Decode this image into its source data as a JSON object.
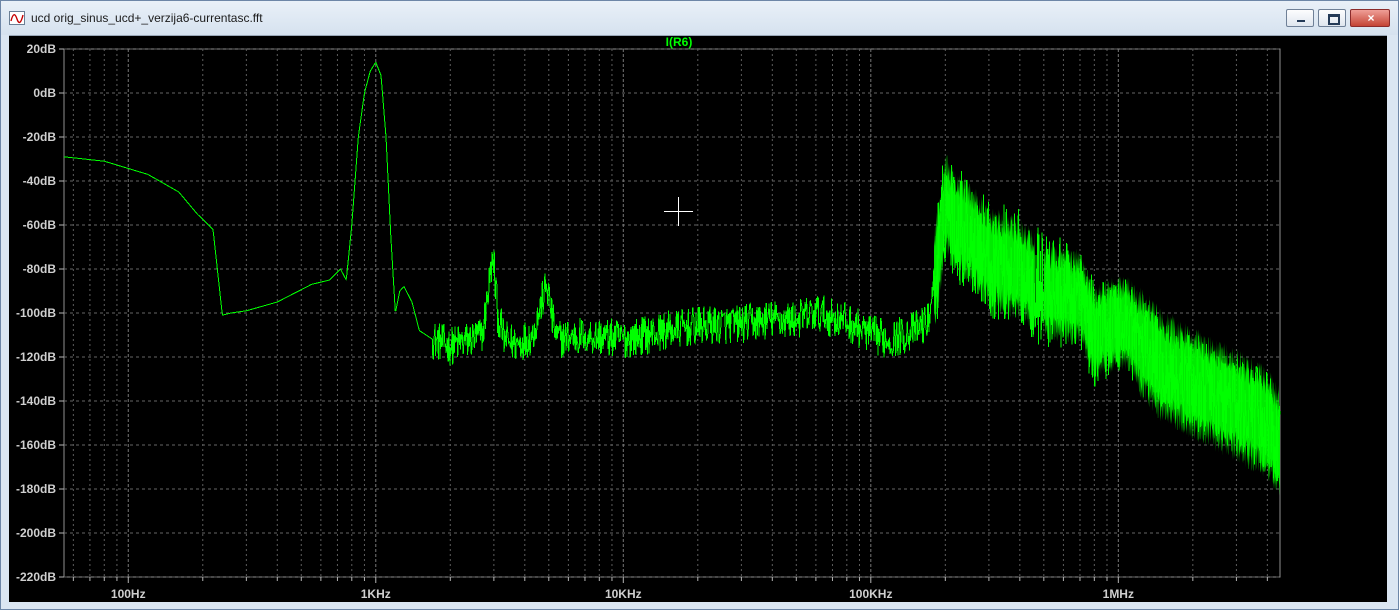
{
  "window": {
    "title": "ucd orig_sinus_ucd+_verzija6-currentasc.fft"
  },
  "plot": {
    "trace_name": "I(R6)",
    "y_ticks": [
      "20dB",
      "0dB",
      "-20dB",
      "-40dB",
      "-60dB",
      "-80dB",
      "-100dB",
      "-120dB",
      "-140dB",
      "-160dB",
      "-180dB",
      "-200dB",
      "-220dB"
    ],
    "x_ticks": [
      "100Hz",
      "1KHz",
      "10KHz",
      "100KHz",
      "1MHz"
    ]
  },
  "chart_data": {
    "type": "line",
    "x_scale": "log",
    "xlim": [
      55,
      4500000
    ],
    "ylim": [
      -220,
      20
    ],
    "grid": true,
    "legend": "none",
    "series": [
      {
        "name": "I(R6)",
        "color": "#00ff00",
        "x": [
          55,
          80,
          120,
          160,
          190,
          220,
          240,
          260,
          300,
          400,
          550,
          650,
          720,
          760,
          800,
          850,
          900,
          950,
          1000,
          1050,
          1100,
          1150,
          1200,
          1250,
          1300,
          1400,
          1500,
          1700,
          2000,
          2300,
          2700,
          3000,
          3100,
          3300,
          3700,
          4300,
          5000,
          5100,
          5400,
          7000,
          10000,
          15000,
          20000,
          30000,
          40000,
          50000,
          60000,
          80000,
          100000,
          120000,
          150000,
          170000,
          190000,
          200000,
          220000,
          260000,
          300000,
          400000,
          450000,
          500000,
          700000,
          800000,
          900000,
          1000000,
          1100000,
          1200000,
          1500000,
          2000000,
          3000000,
          4000000,
          4500000
        ],
        "y": [
          -29,
          -31,
          -37,
          -45,
          -55,
          -62,
          -101,
          -100,
          -99,
          -95,
          -87,
          -85,
          -80,
          -85,
          -60,
          -20,
          0,
          10,
          14,
          8,
          -20,
          -65,
          -100,
          -90,
          -88,
          -95,
          -108,
          -112,
          -115,
          -113,
          -110,
          -70,
          -100,
          -112,
          -114,
          -110,
          -84,
          -100,
          -112,
          -110,
          -112,
          -108,
          -106,
          -105,
          -103,
          -103,
          -100,
          -104,
          -110,
          -112,
          -108,
          -104,
          -70,
          -50,
          -58,
          -66,
          -75,
          -80,
          -85,
          -90,
          -93,
          -110,
          -106,
          -105,
          -104,
          -112,
          -124,
          -132,
          -142,
          -150,
          -160
        ]
      }
    ]
  }
}
